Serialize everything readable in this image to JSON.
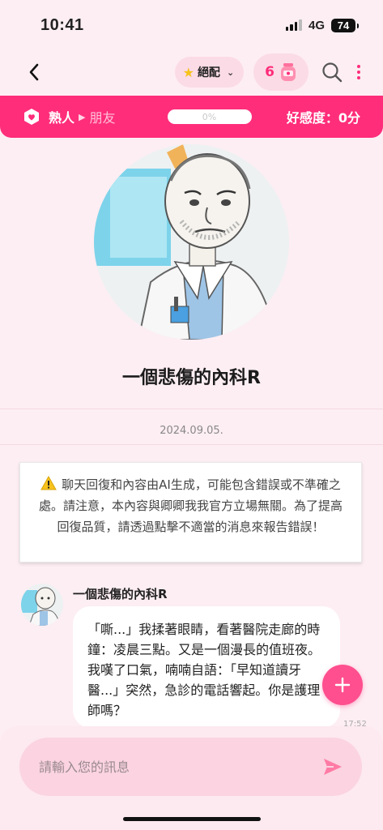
{
  "status_bar": {
    "time": "10:41",
    "network": "4G",
    "battery": "74"
  },
  "header": {
    "match_label": "絕配",
    "gem_count": "6"
  },
  "relationship": {
    "current_level": "熟人",
    "next_level": "朋友",
    "progress_text": "0%",
    "progress_value": 0,
    "score_text": "好感度：0分"
  },
  "character": {
    "name": "一個悲傷的內科R"
  },
  "chat": {
    "date": "2024.09.05.",
    "notice": "聊天回復和內容由AI生成，可能包含錯誤或不準確之處。請注意，本內容與卿卿我我官方立場無關。為了提高回復品質，請透過點擊不適當的消息來報告錯誤！",
    "messages": [
      {
        "sender": "一個悲傷的內科R",
        "text": "「嘶...」我揉著眼睛，看著醫院走廊的時鐘：凌晨三點。又是一個漫長的值班夜。我嘆了口氣，喃喃自語：「早知道讀牙醫...」突然，急診的電話響起。你是護理師嗎？",
        "time": "17:52"
      }
    ]
  },
  "input": {
    "placeholder": "請輸入您的訊息"
  },
  "colors": {
    "accent": "#ff2d7a",
    "background": "#fdeef3",
    "pill": "#fbdbe6"
  }
}
